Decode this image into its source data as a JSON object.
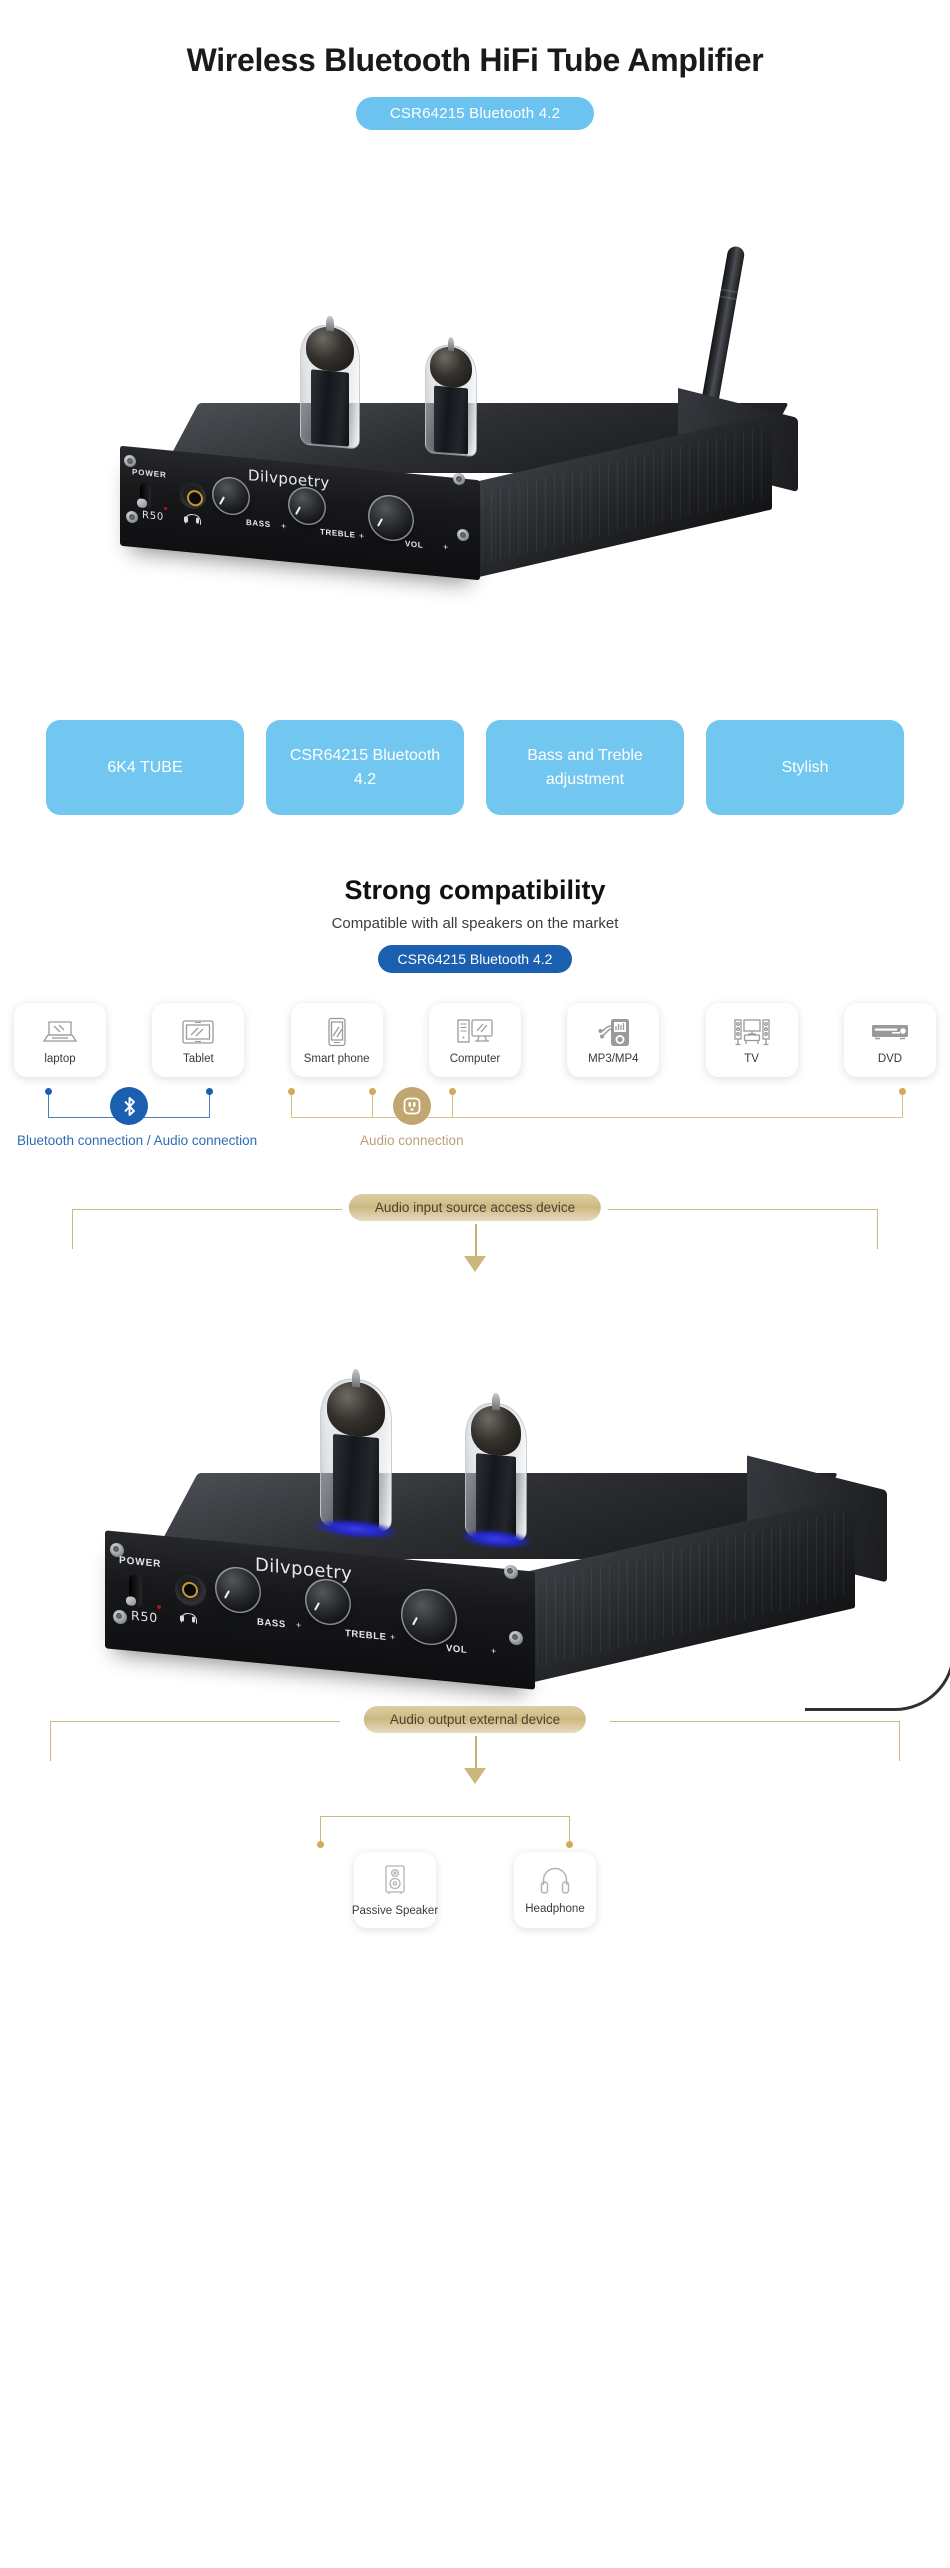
{
  "header": {
    "title": "Wireless Bluetooth HiFi Tube Amplifier",
    "badge": "CSR64215 Bluetooth 4.2"
  },
  "product": {
    "brand": "Dilvpoetry",
    "model": "R50",
    "power_label": "POWER",
    "knobs": [
      {
        "label": "BASS",
        "sign": "+"
      },
      {
        "label": "TREBLE",
        "sign": "+"
      },
      {
        "label": "VOL",
        "sign": "+"
      }
    ]
  },
  "features": [
    {
      "label": "6K4 TUBE"
    },
    {
      "label": "CSR64215\nBluetooth 4.2"
    },
    {
      "label": "Bass and Treble\nadjustment"
    },
    {
      "label": "Stylish"
    }
  ],
  "compatibility": {
    "heading": "Strong compatibility",
    "subheading": "Compatible with all speakers on the market",
    "badge": "CSR64215 Bluetooth 4.2"
  },
  "devices": [
    {
      "label": "laptop",
      "icon": "laptop-icon",
      "conn": "bluetooth"
    },
    {
      "label": "Tablet",
      "icon": "tablet-icon",
      "conn": "bluetooth"
    },
    {
      "label": "Smart phone",
      "icon": "smartphone-icon",
      "conn": "bluetooth"
    },
    {
      "label": "Computer",
      "icon": "desktop-computer-icon",
      "conn": "audio"
    },
    {
      "label": "MP3/MP4",
      "icon": "mp3-player-icon",
      "conn": "audio"
    },
    {
      "label": "TV",
      "icon": "tv-icon",
      "conn": "audio"
    },
    {
      "label": "DVD",
      "icon": "dvd-player-icon",
      "conn": "audio"
    }
  ],
  "connections": {
    "bluetooth_label": "Bluetooth connection / Audio connection",
    "audio_label": "Audio connection"
  },
  "banners": {
    "input": "Audio input source access device",
    "output": "Audio output external device"
  },
  "outputs": [
    {
      "label": "Passive Speaker",
      "icon": "speaker-icon"
    },
    {
      "label": "Headphone",
      "icon": "headphone-icon"
    }
  ],
  "colors": {
    "accent_light_blue": "#71c7ef",
    "accent_blue": "#1b5fb0",
    "gold": "#cdb882",
    "tube_glow": "#2226c4"
  }
}
